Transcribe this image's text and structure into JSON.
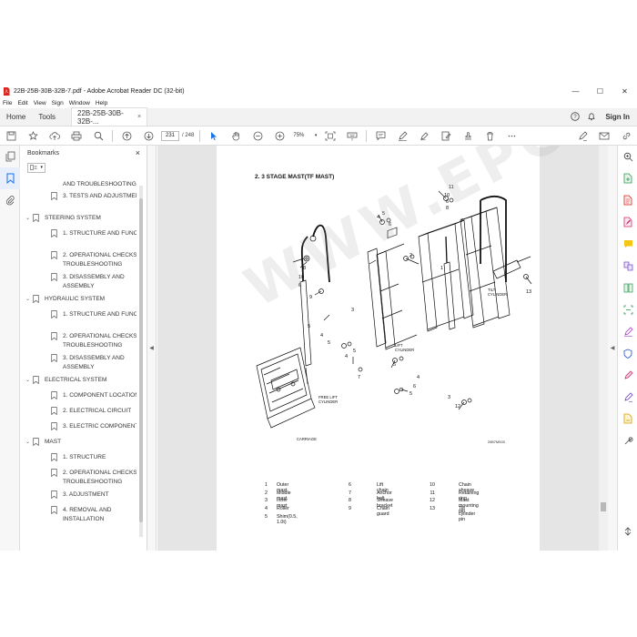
{
  "window": {
    "title": "22B-25B-30B-32B-7.pdf - Adobe Acrobat Reader DC (32-bit)",
    "minimize": "—",
    "maximize": "☐",
    "close": "✕"
  },
  "menu": [
    "File",
    "Edit",
    "View",
    "Sign",
    "Window",
    "Help"
  ],
  "tabs": {
    "home": "Home",
    "tools": "Tools",
    "doc": "22B-25B-30B-32B-...",
    "doc_close": "×",
    "sign_in": "Sign In"
  },
  "toolbar": {
    "page_current": "231",
    "page_total": "/ 248",
    "zoom": "75%"
  },
  "bookmarks": {
    "title": "Bookmarks",
    "close": "×",
    "items": [
      {
        "label": "AND TROUBLESHOOTING",
        "level": 2,
        "chevron": ""
      },
      {
        "label": "3. TESTS AND ADJUSTMENTS",
        "level": 2,
        "chevron": ""
      },
      {
        "label": "STEERING SYSTEM",
        "level": 1,
        "chevron": "⌄"
      },
      {
        "label": "1. STRUCTURE AND FUNCTION",
        "level": 2,
        "chevron": ""
      },
      {
        "label": "2. OPERATIONAL CHECKS AND TROUBLESHOOTING",
        "level": 2,
        "chevron": ""
      },
      {
        "label": "3. DISASSEMBLY AND ASSEMBLY",
        "level": 2,
        "chevron": ""
      },
      {
        "label": "HYDRAULIC SYSTEM",
        "level": 1,
        "chevron": "⌄"
      },
      {
        "label": "1. STRUCTURE AND FUNCTION",
        "level": 2,
        "chevron": ""
      },
      {
        "label": "2. OPERATIONAL CHECKS AND TROUBLESHOOTING",
        "level": 2,
        "chevron": ""
      },
      {
        "label": "3. DISASSEMBLY AND ASSEMBLY",
        "level": 2,
        "chevron": ""
      },
      {
        "label": "ELECTRICAL SYSTEM",
        "level": 1,
        "chevron": "⌄"
      },
      {
        "label": "1. COMPONENT LOCATION",
        "level": 2,
        "chevron": ""
      },
      {
        "label": "2. ELECTRICAL CIRCUIT",
        "level": 2,
        "chevron": ""
      },
      {
        "label": "3. ELECTRIC COMPONENTS",
        "level": 2,
        "chevron": ""
      },
      {
        "label": "MAST",
        "level": 1,
        "chevron": "⌄"
      },
      {
        "label": "1. STRUCTURE",
        "level": 2,
        "chevron": ""
      },
      {
        "label": "2. OPERATIONAL CHECKS AND TROUBLESHOOTING",
        "level": 2,
        "chevron": ""
      },
      {
        "label": "3. ADJUSTMENT",
        "level": 2,
        "chevron": ""
      },
      {
        "label": "4. REMOVAL AND INSTALLATION",
        "level": 2,
        "chevron": ""
      }
    ]
  },
  "document": {
    "heading": "2. 3 STAGE MAST(TF MAST)",
    "watermark": "WWW.EPCDS.COM",
    "part_code": "20B7MS03",
    "labels": {
      "tilt_cylinder": "TILT\nCYLINDER",
      "lift_cylinder": "LIFT\nCYLINDER",
      "free_lift_cylinder": "FREE LIFT\nCYLINDER",
      "carriage": "CARRIAGE"
    },
    "legend": [
      {
        "num": "1",
        "label": "Outer mast"
      },
      {
        "num": "2",
        "label": "Middle mast"
      },
      {
        "num": "3",
        "label": "Inner mast"
      },
      {
        "num": "4",
        "label": "Roller"
      },
      {
        "num": "5",
        "label": "Shim(0.5, 1.0t)"
      },
      {
        "num": "6",
        "label": "Lift chain"
      },
      {
        "num": "7",
        "label": "Anchor bolt"
      },
      {
        "num": "8",
        "label": "Sheave bracket"
      },
      {
        "num": "9",
        "label": "Chain guard"
      },
      {
        "num": "10",
        "label": "Chain sheave"
      },
      {
        "num": "11",
        "label": "Retaining ring"
      },
      {
        "num": "12",
        "label": "Mast mounting pin"
      },
      {
        "num": "13",
        "label": "Tilt cylinder pin"
      }
    ]
  },
  "colors": {
    "accent_blue": "#1a73e8",
    "acrobat_red": "#d9251d"
  }
}
